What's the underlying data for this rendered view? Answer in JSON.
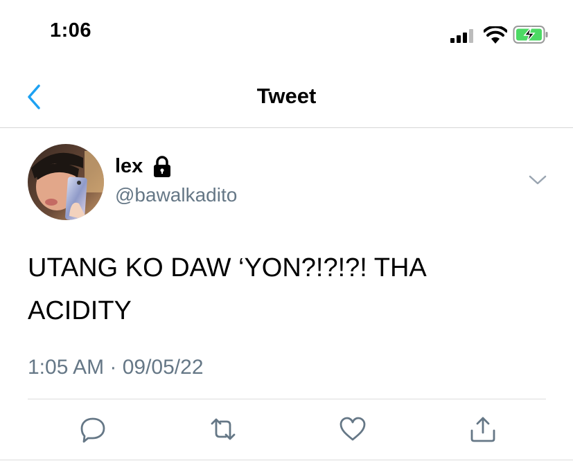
{
  "status_bar": {
    "time": "1:06",
    "icons": [
      "cellular-signal-icon",
      "wifi-icon",
      "battery-charging-icon"
    ],
    "battery_color": "#4cd964"
  },
  "nav": {
    "title": "Tweet",
    "back_icon": "chevron-left-icon",
    "accent_color": "#1da1f2"
  },
  "tweet": {
    "author": {
      "display_name": "lex",
      "handle": "@bawalkadito",
      "protected_icon": "lock-icon"
    },
    "more_icon": "chevron-down-icon",
    "text_line_1": "UTANG KO DAW ‘YON?!?!?! THA",
    "text_line_2": "ACIDITY",
    "timestamp": "1:05 AM · 09/05/22"
  },
  "actions": [
    {
      "name": "reply",
      "icon": "reply-icon"
    },
    {
      "name": "retweet",
      "icon": "retweet-icon"
    },
    {
      "name": "like",
      "icon": "heart-icon"
    },
    {
      "name": "share",
      "icon": "share-icon"
    }
  ],
  "colors": {
    "secondary_text": "#657786",
    "icon_gray": "#657786",
    "divider": "#dcdcdc"
  }
}
